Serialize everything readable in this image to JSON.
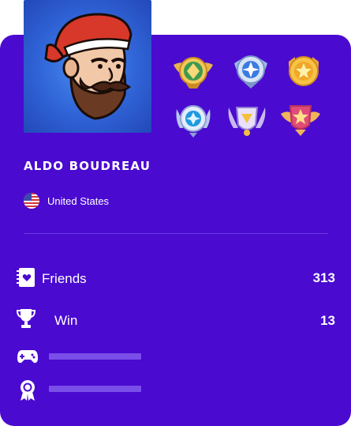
{
  "profile": {
    "name": "ALDO BOUDREAU",
    "country": "United States"
  },
  "badges": [
    "green-diamond-wing-badge",
    "blue-star-shield-badge",
    "gold-star-medal-badge",
    "blue-crystal-orb-badge",
    "gold-gem-crest-badge",
    "gold-star-winged-crest-badge"
  ],
  "stats": [
    {
      "label": "Friends",
      "value": "313",
      "icon": "friends-book-icon"
    },
    {
      "label": "Win",
      "value": "13",
      "icon": "trophy-icon"
    },
    {
      "label": "",
      "value": "",
      "icon": "gamepad-icon"
    },
    {
      "label": "",
      "value": "",
      "icon": "award-ribbon-icon"
    }
  ],
  "colors": {
    "card_background": "#4a0ad0",
    "avatar_background": "#2f63d6",
    "placeholder_bar": "#7a4ee8",
    "text": "#ffffff"
  }
}
